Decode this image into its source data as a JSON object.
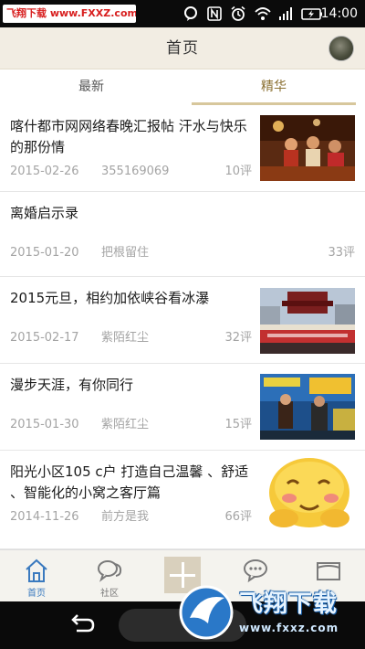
{
  "statusbar": {
    "watermark": "飞翔下载 www.FXXZ.com",
    "time": "14:00",
    "icons": [
      "chat-bubble-icon",
      "nfc-icon",
      "alarm-icon",
      "wifi-icon",
      "signal-icon",
      "battery-icon"
    ]
  },
  "header": {
    "title": "首页"
  },
  "tabs": [
    {
      "label": "最新",
      "active": false
    },
    {
      "label": "精华",
      "active": true
    }
  ],
  "feed": [
    {
      "title": "喀什都市网网络春晚汇报帖 汗水与快乐的那份情",
      "date": "2015-02-26",
      "author": "355169069",
      "count": "10评",
      "has_image": true
    },
    {
      "title": "离婚启示录",
      "date": "2015-01-20",
      "author": "把根留住",
      "count": "33评",
      "has_image": false
    },
    {
      "title": "2015元旦，相约加依峡谷看冰瀑",
      "date": "2015-02-17",
      "author": "紫陌红尘",
      "count": "32评",
      "has_image": true
    },
    {
      "title": "漫步天涯，有你同行",
      "date": "2015-01-30",
      "author": "紫陌红尘",
      "count": "15评",
      "has_image": true
    },
    {
      "title": "阳光小区105 c户  打造自己温馨 、舒适 、智能化的小窝之客厅篇",
      "date": "2014-11-26",
      "author": "前方是我",
      "count": "66评",
      "has_image": true
    }
  ],
  "bottomnav": [
    {
      "label": "首页",
      "icon": "house-icon",
      "active": true
    },
    {
      "label": "社区",
      "icon": "chat-bubbles-icon",
      "active": false
    },
    {
      "label": "",
      "icon": "plus-icon",
      "active": false
    },
    {
      "label": "",
      "icon": "message-icon",
      "active": false
    },
    {
      "label": "",
      "icon": "folder-icon",
      "active": false
    }
  ],
  "watermark_bottom": {
    "text": "飞翔下载",
    "url": "www.fxxz.com"
  },
  "colors": {
    "header_bg": "#f2ede3",
    "tab_active": "#8a6f30",
    "nav_active": "#3a7abf",
    "meta_text": "#a4a4a4"
  }
}
